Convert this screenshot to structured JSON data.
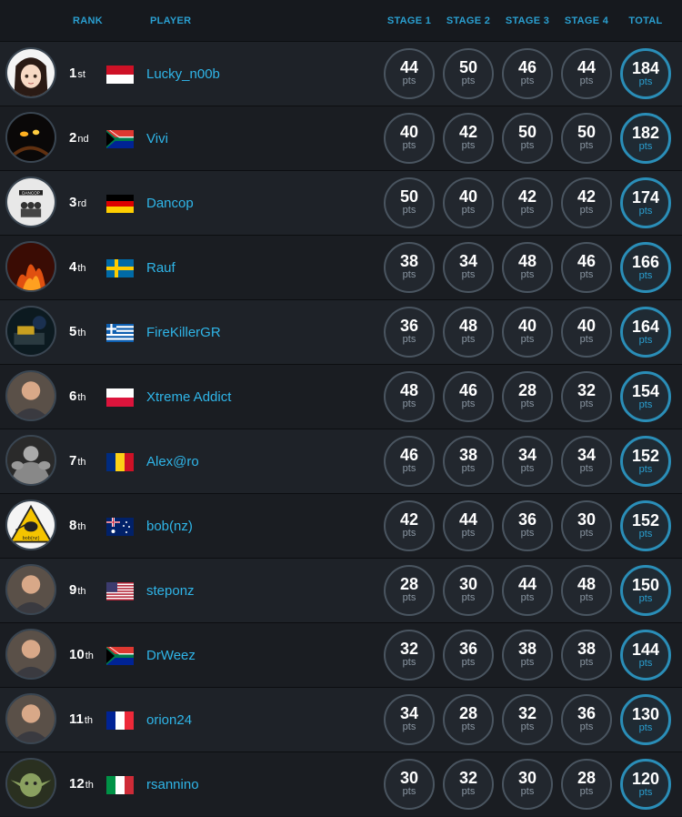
{
  "header": {
    "rank": "RANK",
    "player": "PLAYER",
    "stage1": "STAGE 1",
    "stage2": "STAGE 2",
    "stage3": "STAGE 3",
    "stage4": "STAGE 4",
    "total": "TOTAL"
  },
  "unit": "pts",
  "colors": {
    "accent": "#2fb5e8",
    "total_ring": "#2a8eb8",
    "background": "#16191e"
  },
  "rows": [
    {
      "rank": "1",
      "suffix": "st",
      "name": "Lucky_n00b",
      "flag": "monaco-flag",
      "avatar": "anime-girl-avatar",
      "s1": "44",
      "s2": "50",
      "s3": "46",
      "s4": "44",
      "total": "184"
    },
    {
      "rank": "2",
      "suffix": "nd",
      "name": "Vivi",
      "flag": "south-africa-flag",
      "avatar": "dark-character-avatar",
      "s1": "40",
      "s2": "42",
      "s3": "50",
      "s4": "50",
      "total": "182"
    },
    {
      "rank": "3",
      "suffix": "rd",
      "name": "Dancop",
      "flag": "germany-flag",
      "avatar": "dancop-logo-avatar",
      "s1": "50",
      "s2": "40",
      "s3": "42",
      "s4": "42",
      "total": "174"
    },
    {
      "rank": "4",
      "suffix": "th",
      "name": "Rauf",
      "flag": "sweden-flag",
      "avatar": "fire-avatar",
      "s1": "38",
      "s2": "34",
      "s3": "48",
      "s4": "46",
      "total": "166"
    },
    {
      "rank": "5",
      "suffix": "th",
      "name": "FireKillerGR",
      "flag": "greece-flag",
      "avatar": "hardware-avatar",
      "s1": "36",
      "s2": "48",
      "s3": "40",
      "s4": "40",
      "total": "164"
    },
    {
      "rank": "6",
      "suffix": "th",
      "name": "Xtreme Addict",
      "flag": "poland-flag",
      "avatar": "person-photo-avatar",
      "s1": "48",
      "s2": "46",
      "s3": "28",
      "s4": "32",
      "total": "154"
    },
    {
      "rank": "7",
      "suffix": "th",
      "name": "Alex@ro",
      "flag": "romania-flag",
      "avatar": "bodybuilder-avatar",
      "s1": "46",
      "s2": "38",
      "s3": "34",
      "s4": "34",
      "total": "152"
    },
    {
      "rank": "8",
      "suffix": "th",
      "name": "bob(nz)",
      "flag": "australia-flag",
      "avatar": "kiwi-sign-avatar",
      "s1": "42",
      "s2": "44",
      "s3": "36",
      "s4": "30",
      "total": "152",
      "avatar_text": "bob(nz)"
    },
    {
      "rank": "9",
      "suffix": "th",
      "name": "steponz",
      "flag": "usa-flag",
      "avatar": "person-photo-avatar",
      "s1": "28",
      "s2": "30",
      "s3": "44",
      "s4": "48",
      "total": "150"
    },
    {
      "rank": "10",
      "suffix": "th",
      "name": "DrWeez",
      "flag": "south-africa-flag",
      "avatar": "person-photo-avatar",
      "s1": "32",
      "s2": "36",
      "s3": "38",
      "s4": "38",
      "total": "144"
    },
    {
      "rank": "11",
      "suffix": "th",
      "name": "orion24",
      "flag": "france-flag",
      "avatar": "person-photo-avatar",
      "s1": "34",
      "s2": "28",
      "s3": "32",
      "s4": "36",
      "total": "130"
    },
    {
      "rank": "12",
      "suffix": "th",
      "name": "rsannino",
      "flag": "italy-flag",
      "avatar": "yoda-avatar",
      "s1": "30",
      "s2": "32",
      "s3": "30",
      "s4": "28",
      "total": "120"
    }
  ]
}
